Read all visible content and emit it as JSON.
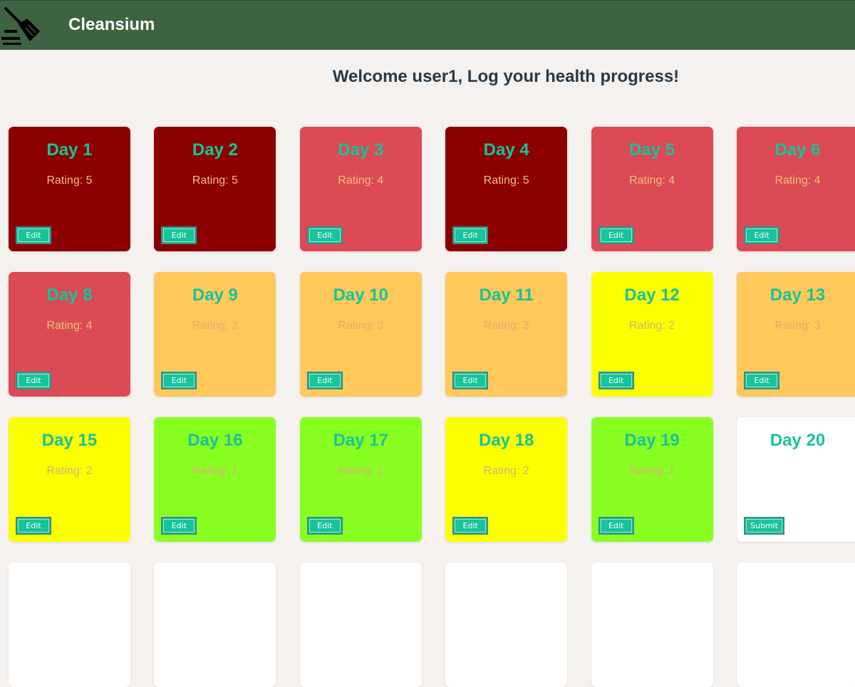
{
  "navbar": {
    "brand": "Cleansium",
    "logo_icon": "broom-icon",
    "background": "#3d6340"
  },
  "welcome": "Welcome user1, Log your health progress!",
  "colors": {
    "rating_5": "#8b0000",
    "rating_4": "#dc4a55",
    "rating_3": "#fec85a",
    "rating_2": "#fbff00",
    "rating_1": "#88ff20",
    "empty": "#ffffff",
    "title": "#17c39a",
    "button": "#17c39a"
  },
  "days": [
    {
      "title": "Day 1",
      "rating": "Rating: 5",
      "level": 5,
      "button": "Edit"
    },
    {
      "title": "Day 2",
      "rating": "Rating: 5",
      "level": 5,
      "button": "Edit"
    },
    {
      "title": "Day 3",
      "rating": "Rating: 4",
      "level": 4,
      "button": "Edit"
    },
    {
      "title": "Day 4",
      "rating": "Rating: 5",
      "level": 5,
      "button": "Edit"
    },
    {
      "title": "Day 5",
      "rating": "Rating: 4",
      "level": 4,
      "button": "Edit"
    },
    {
      "title": "Day 6",
      "rating": "Rating: 4",
      "level": 4,
      "button": "Edit"
    },
    {
      "title": "Day 8",
      "rating": "Rating: 4",
      "level": 4,
      "button": "Edit"
    },
    {
      "title": "Day 9",
      "rating": "Rating: 3",
      "level": 3,
      "button": "Edit"
    },
    {
      "title": "Day 10",
      "rating": "Rating: 3",
      "level": 3,
      "button": "Edit"
    },
    {
      "title": "Day 11",
      "rating": "Rating: 3",
      "level": 3,
      "button": "Edit"
    },
    {
      "title": "Day 12",
      "rating": "Rating: 2",
      "level": 2,
      "button": "Edit"
    },
    {
      "title": "Day 13",
      "rating": "Rating: 3",
      "level": 3,
      "button": "Edit"
    },
    {
      "title": "Day 15",
      "rating": "Rating: 2",
      "level": 2,
      "button": "Edit"
    },
    {
      "title": "Day 16",
      "rating": "Rating: 1",
      "level": 1,
      "button": "Edit"
    },
    {
      "title": "Day 17",
      "rating": "Rating: 1",
      "level": 1,
      "button": "Edit"
    },
    {
      "title": "Day 18",
      "rating": "Rating: 2",
      "level": 2,
      "button": "Edit"
    },
    {
      "title": "Day 19",
      "rating": "Rating: 1",
      "level": 1,
      "button": "Edit"
    },
    {
      "title": "Day 20",
      "rating": "",
      "level": 0,
      "button": "Submit"
    }
  ],
  "next_row_count": 6
}
